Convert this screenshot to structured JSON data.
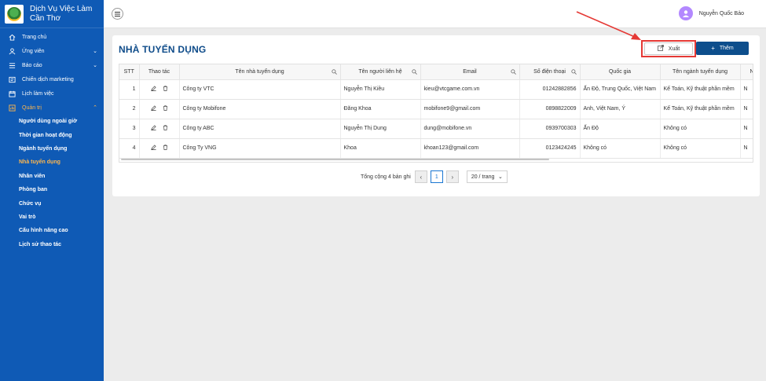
{
  "brand": {
    "line1": "Dịch Vụ Việc Làm",
    "line2": "Cần Thơ"
  },
  "sidebar": {
    "items": [
      {
        "label": "Trang chủ",
        "icon": "home-icon"
      },
      {
        "label": "Ứng viên",
        "icon": "users-icon",
        "chevron": "expand"
      },
      {
        "label": "Báo cáo",
        "icon": "list-icon",
        "chevron": "expand"
      },
      {
        "label": "Chiến dịch marketing",
        "icon": "campaign-icon"
      },
      {
        "label": "Lịch làm việc",
        "icon": "calendar-icon"
      },
      {
        "label": "Quản trị",
        "icon": "admin-icon",
        "chevron": "collapse"
      }
    ],
    "subitems": [
      "Người dùng ngoài giờ",
      "Thời gian hoạt động",
      "Ngành tuyển dụng",
      "Nhà tuyển dụng",
      "Nhân viên",
      "Phòng ban",
      "Chức vụ",
      "Vai trò",
      "Cấu hình nâng cao",
      "Lịch sử thao tác"
    ],
    "active_subitem": "Nhà tuyển dụng"
  },
  "header": {
    "user_name": "Nguyễn Quốc Bảo"
  },
  "page": {
    "title": "NHÀ TUYỂN DỤNG",
    "export_label": "Xuất",
    "add_label": "Thêm"
  },
  "table": {
    "headers": [
      "STT",
      "Thao tác",
      "Tên nhà tuyển dụng",
      "Tên người liên hệ",
      "Email",
      "Số điện thoại",
      "Quốc gia",
      "Tên ngành tuyển dụng",
      "N"
    ],
    "rows": [
      [
        "1",
        "",
        "Công ty VTC",
        "Nguyễn Thị Kiều",
        "kieu@vtcgame.com.vn",
        "01242882856",
        "Ấn Độ, Trung Quốc, Việt Nam",
        "Kế Toán, Kỹ thuật phần mềm",
        "N"
      ],
      [
        "2",
        "",
        "Công ty Mobifone",
        "Đăng Khoa",
        "mobifone9@gmail.com",
        "0898822009",
        "Anh, Việt Nam, Ý",
        "Kế Toán, Kỹ thuật phần mềm",
        "N"
      ],
      [
        "3",
        "",
        "Công ty ABC",
        "Nguyễn Thị Dung",
        "dung@mobifone.vn",
        "0939700303",
        "Ấn Độ",
        "Không có",
        "N"
      ],
      [
        "4",
        "",
        "Công Ty VNG",
        "Khoa",
        "khoan123@gmail.com",
        "0123424245",
        "Không có",
        "Không có",
        "N"
      ]
    ]
  },
  "pagination": {
    "total_text": "Tổng cộng 4 bản ghi",
    "current_page": "1",
    "page_size": "20 / trang"
  },
  "colors": {
    "sidebar_bg": "#0f5ab5",
    "active_accent": "#ffb74d",
    "primary_button": "#0d4e8c",
    "annotation_red": "#e53935"
  }
}
